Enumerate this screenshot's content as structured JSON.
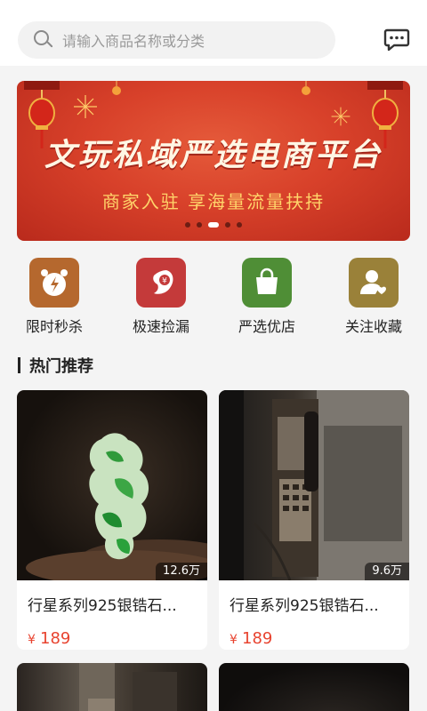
{
  "search": {
    "placeholder": "请输入商品名称或分类"
  },
  "banner": {
    "title": "文玩私域严选电商平台",
    "subtitle": "商家入驻 享海量流量扶持",
    "slide_count": 5,
    "active_slide": 2
  },
  "categories": [
    {
      "label": "限时秒杀",
      "icon": "alarm-clock-icon",
      "color": "#b5682e"
    },
    {
      "label": "极速捡漏",
      "icon": "money-bag-rocket-icon",
      "color": "#c43a3a"
    },
    {
      "label": "严选优店",
      "icon": "shopping-bag-icon",
      "color": "#4f8e36"
    },
    {
      "label": "关注收藏",
      "icon": "user-heart-icon",
      "color": "#9a8139"
    }
  ],
  "section": {
    "title": "热门推荐"
  },
  "products": [
    {
      "title": "行星系列925银锆石...",
      "price_symbol": "¥",
      "price": "189",
      "views": "12.6万",
      "image": "jade-carving"
    },
    {
      "title": "行星系列925银锆石...",
      "price_symbol": "¥",
      "price": "189",
      "views": "9.6万",
      "image": "payphone"
    },
    {
      "title": "",
      "price_symbol": "",
      "price": "",
      "views": "",
      "image": "street-scene"
    },
    {
      "title": "",
      "price_symbol": "",
      "price": "",
      "views": "",
      "image": "dark-scene"
    }
  ],
  "colors": {
    "accent": "#e8432f",
    "banner": "#d8412a"
  }
}
